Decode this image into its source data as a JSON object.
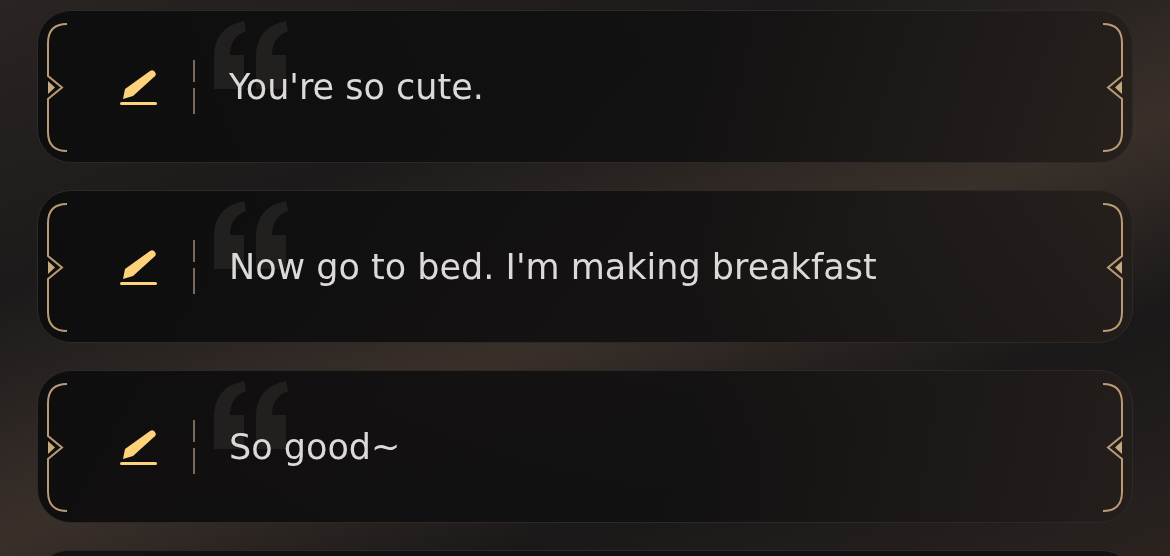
{
  "options": [
    {
      "text": "You're so cute."
    },
    {
      "text": "Now go to bed. I'm making breakfast"
    },
    {
      "text": "So good~"
    }
  ]
}
